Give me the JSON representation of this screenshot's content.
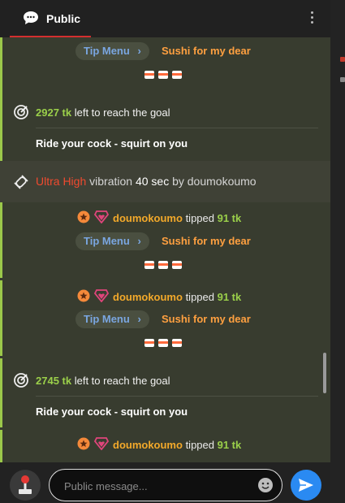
{
  "header": {
    "tab_label": "Public"
  },
  "colors": {
    "accent_red": "#d32f2f",
    "goal_green": "#9bd04a",
    "tip_orange": "#ffa040",
    "user_gold": "#f3a92a",
    "send_blue": "#2a8af2"
  },
  "icons": {
    "tab": "chat-bubble-icon",
    "menu": "more-vertical-icon",
    "goal": "target-icon",
    "vibration": "vibration-icon",
    "send": "send-icon",
    "emoji": "emoji-icon",
    "joystick": "joystick-icon"
  },
  "feed": {
    "tipmenu_1": {
      "pill": "Tip Menu",
      "item": "Sushi for my dear"
    },
    "goal_1": {
      "amount": "2927 tk",
      "text": "left to reach the goal",
      "subtitle": "Ride your cock - squirt on you"
    },
    "vibration": {
      "level": "Ultra High",
      "mid": "vibration",
      "duration": "40 sec",
      "by": "by doumokoumo"
    },
    "tip_1": {
      "user": "doumokoumo",
      "verb": "tipped",
      "amount": "91 tk",
      "pill": "Tip Menu",
      "item": "Sushi for my dear"
    },
    "tip_2": {
      "user": "doumokoumo",
      "verb": "tipped",
      "amount": "91 tk",
      "pill": "Tip Menu",
      "item": "Sushi for my dear"
    },
    "goal_2": {
      "amount": "2745 tk",
      "text": "left to reach the goal",
      "subtitle": "Ride your cock - squirt on you"
    },
    "tip_3": {
      "user": "doumokoumo",
      "verb": "tipped",
      "amount": "91 tk"
    }
  },
  "composer": {
    "placeholder": "Public message..."
  }
}
